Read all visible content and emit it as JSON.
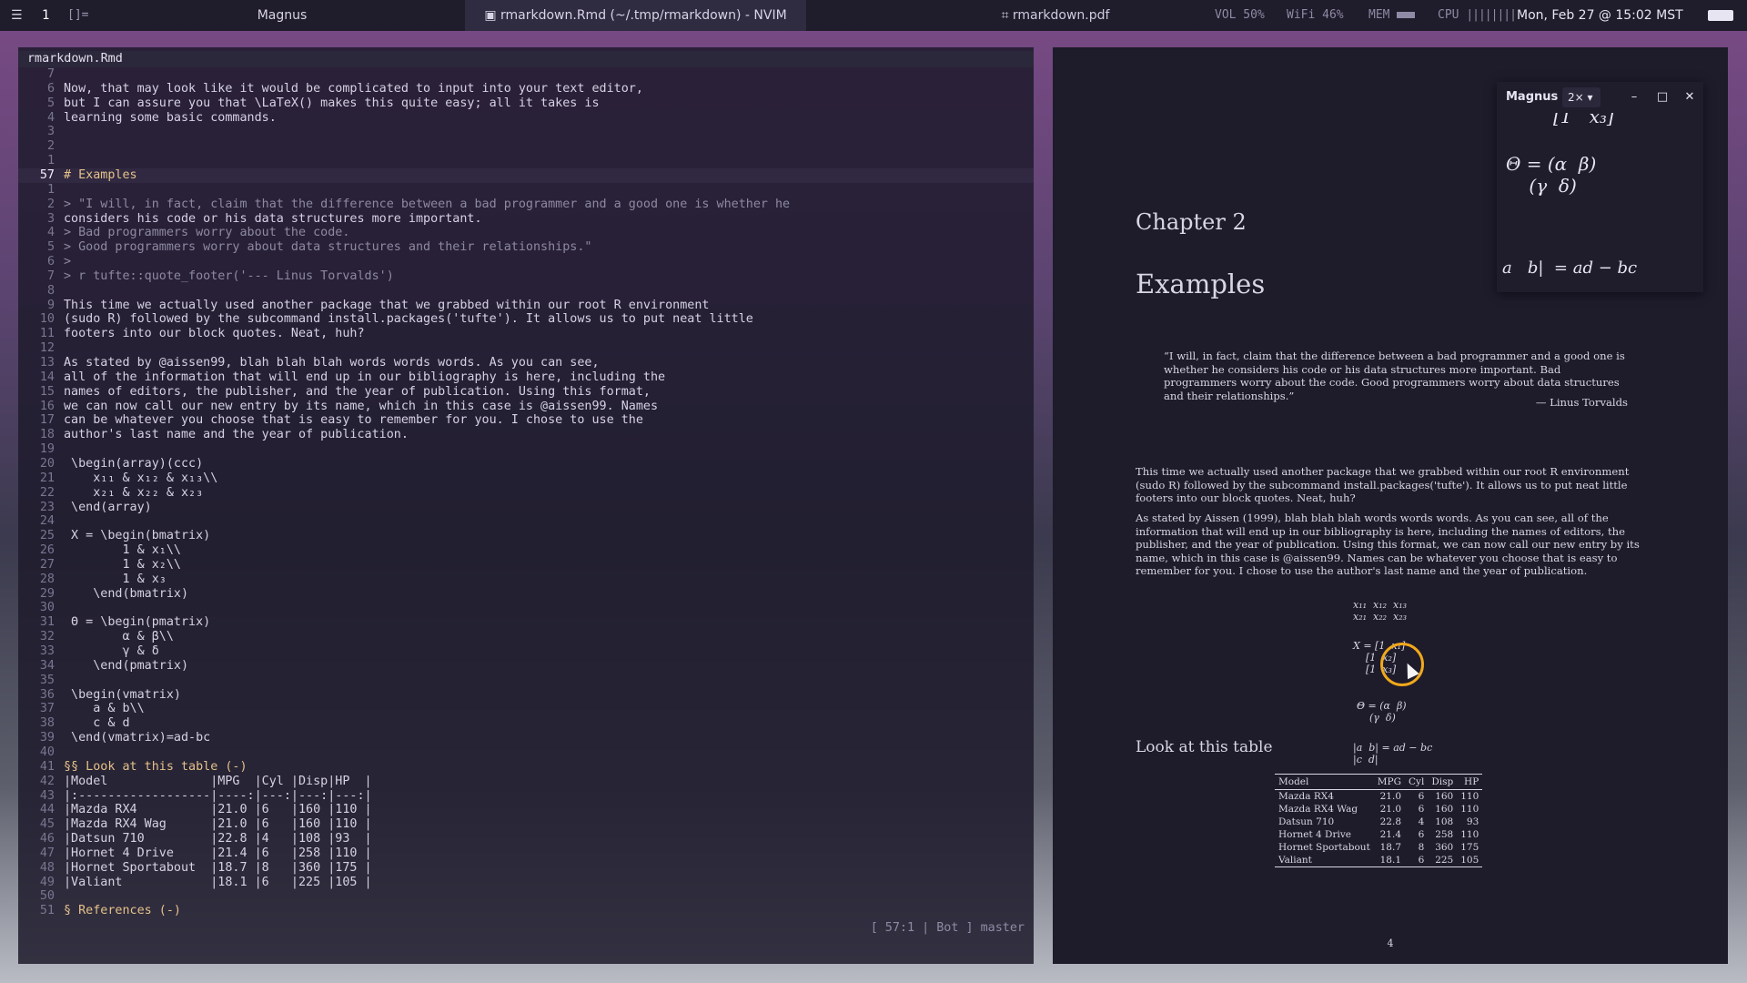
{
  "topbar": {
    "workspace": "1",
    "layout_indicator": "[]=",
    "windows": [
      "Magnus",
      "rmarkdown.Rmd (~/.tmp/rmarkdown) - NVIM",
      "rmarkdown.pdf"
    ],
    "vol": "VOL 50%",
    "wifi": "WiFi 46%",
    "mem": "MEM",
    "cpu": "CPU",
    "clock": "Mon, Feb 27 @ 15:02 MST"
  },
  "nvim": {
    "tab": "rmarkdown.Rmd",
    "lines": [
      {
        "n": "7",
        "t": ""
      },
      {
        "n": "6",
        "t": "Now, that may look like it would be complicated to input into your text editor,"
      },
      {
        "n": "5",
        "t": "but I can assure you that \\LaTeX() makes this quite easy; all it takes is"
      },
      {
        "n": "4",
        "t": "learning some basic commands."
      },
      {
        "n": "3",
        "t": ""
      },
      {
        "n": "2",
        "t": ""
      },
      {
        "n": "1",
        "t": ""
      },
      {
        "n": "57",
        "t": "# Examples"
      },
      {
        "n": "1",
        "t": ""
      },
      {
        "n": "2",
        "t": "> \"I will, in fact, claim that the difference between a bad programmer and a good one is whether he"
      },
      {
        "n": "3",
        "t": "considers his code or his data structures more important."
      },
      {
        "n": "4",
        "t": "> Bad programmers worry about the code."
      },
      {
        "n": "5",
        "t": "> Good programmers worry about data structures and their relationships.\""
      },
      {
        "n": "6",
        "t": ">"
      },
      {
        "n": "7",
        "t": "> r tufte::quote_footer('--- Linus Torvalds')"
      },
      {
        "n": "8",
        "t": ""
      },
      {
        "n": "9",
        "t": "This time we actually used another package that we grabbed within our root R environment"
      },
      {
        "n": "10",
        "t": "(sudo R) followed by the subcommand install.packages('tufte'). It allows us to put neat little"
      },
      {
        "n": "11",
        "t": "footers into our block quotes. Neat, huh?"
      },
      {
        "n": "12",
        "t": ""
      },
      {
        "n": "13",
        "t": "As stated by @aissen99, blah blah blah words words words. As you can see,"
      },
      {
        "n": "14",
        "t": "all of the information that will end up in our bibliography is here, including the"
      },
      {
        "n": "15",
        "t": "names of editors, the publisher, and the year of publication. Using this format,"
      },
      {
        "n": "16",
        "t": "we can now call our new entry by its name, which in this case is @aissen99. Names"
      },
      {
        "n": "17",
        "t": "can be whatever you choose that is easy to remember for you. I chose to use the"
      },
      {
        "n": "18",
        "t": "author's last name and the year of publication."
      },
      {
        "n": "19",
        "t": ""
      },
      {
        "n": "20",
        "t": " \\begin(array)(ccc)"
      },
      {
        "n": "21",
        "t": "    x₁₁ & x₁₂ & x₁₃\\\\"
      },
      {
        "n": "22",
        "t": "    x₂₁ & x₂₂ & x₂₃"
      },
      {
        "n": "23",
        "t": " \\end(array)"
      },
      {
        "n": "24",
        "t": ""
      },
      {
        "n": "25",
        "t": " X = \\begin(bmatrix)"
      },
      {
        "n": "26",
        "t": "        1 & x₁\\\\"
      },
      {
        "n": "27",
        "t": "        1 & x₂\\\\"
      },
      {
        "n": "28",
        "t": "        1 & x₃"
      },
      {
        "n": "29",
        "t": "    \\end(bmatrix)"
      },
      {
        "n": "30",
        "t": ""
      },
      {
        "n": "31",
        "t": " Θ = \\begin(pmatrix)"
      },
      {
        "n": "32",
        "t": "        α & β\\\\"
      },
      {
        "n": "33",
        "t": "        γ & δ"
      },
      {
        "n": "34",
        "t": "    \\end(pmatrix)"
      },
      {
        "n": "35",
        "t": ""
      },
      {
        "n": "36",
        "t": " \\begin(vmatrix)"
      },
      {
        "n": "37",
        "t": "    a & b\\\\"
      },
      {
        "n": "38",
        "t": "    c & d"
      },
      {
        "n": "39",
        "t": " \\end(vmatrix)=ad-bc"
      },
      {
        "n": "40",
        "t": ""
      },
      {
        "n": "41",
        "t": "§§ Look at this table (-)"
      },
      {
        "n": "42",
        "t": "|Model              |MPG  |Cyl |Disp|HP  |"
      },
      {
        "n": "43",
        "t": "|:------------------|----:|---:|---:|---:|"
      },
      {
        "n": "44",
        "t": "|Mazda RX4          |21.0 |6   |160 |110 |"
      },
      {
        "n": "45",
        "t": "|Mazda RX4 Wag      |21.0 |6   |160 |110 |"
      },
      {
        "n": "46",
        "t": "|Datsun 710         |22.8 |4   |108 |93  |"
      },
      {
        "n": "47",
        "t": "|Hornet 4 Drive     |21.4 |6   |258 |110 |"
      },
      {
        "n": "48",
        "t": "|Hornet Sportabout  |18.7 |8   |360 |175 |"
      },
      {
        "n": "49",
        "t": "|Valiant            |18.1 |6   |225 |105 |"
      },
      {
        "n": "50",
        "t": ""
      },
      {
        "n": "51",
        "t": "§ References (-)"
      }
    ],
    "status": "[ 57:1 | Bot ]  master"
  },
  "pdf": {
    "chapter": "Chapter 2",
    "title": "Examples",
    "quote": "“I will, in fact, claim that the difference between a bad programmer and a good one is whether he considers his code or his data structures more important. Bad programmers worry about the code. Good programmers worry about data structures and their relationships.”",
    "attribution": "— Linus Torvalds",
    "para1": "This time we actually used another package that we grabbed within our root R environment (sudo R) followed by the subcommand install.packages('tufte'). It allows us to put neat little footers into our block quotes. Neat, huh?",
    "para2": "As stated by Aissen (1999), blah blah blah words words words. As you can see, all of the information that will end up in our bibliography is here, including the names of editors, the publisher, and the year of publication. Using this format, we can now call our new entry by its name, which in this case is @aissen99. Names can be whatever you choose that is easy to remember for you. I chose to use the author's last name and the year of publication.",
    "eq_array": "x₁₁  x₁₂  x₁₃\nx₂₁  x₂₂  x₂₃",
    "eq_x": "X = [1  x₁]\n    [1  x₂]\n    [1  x₃]",
    "eq_theta": "Θ = (α  β)\n    (γ  δ)",
    "eq_det": "|a  b| = ad − bc\n|c  d|",
    "table_heading": "Look at this table",
    "table": {
      "headers": [
        "Model",
        "MPG",
        "Cyl",
        "Disp",
        "HP"
      ],
      "rows": [
        [
          "Mazda RX4",
          "21.0",
          "6",
          "160",
          "110"
        ],
        [
          "Mazda RX4 Wag",
          "21.0",
          "6",
          "160",
          "110"
        ],
        [
          "Datsun 710",
          "22.8",
          "4",
          "108",
          "93"
        ],
        [
          "Hornet 4 Drive",
          "21.4",
          "6",
          "258",
          "110"
        ],
        [
          "Hornet Sportabout",
          "18.7",
          "8",
          "360",
          "175"
        ],
        [
          "Valiant",
          "18.1",
          "6",
          "225",
          "105"
        ]
      ]
    },
    "page_number": "4"
  },
  "magnus": {
    "title": "Magnus",
    "zoom": "2×",
    "minimize": "–",
    "maximize": "□",
    "close": "✕",
    "content_top": "[1   x₃]",
    "content_theta": "Θ = (α  β)\n    (γ  δ)",
    "content_det": "a   b|  = ad − bc"
  }
}
